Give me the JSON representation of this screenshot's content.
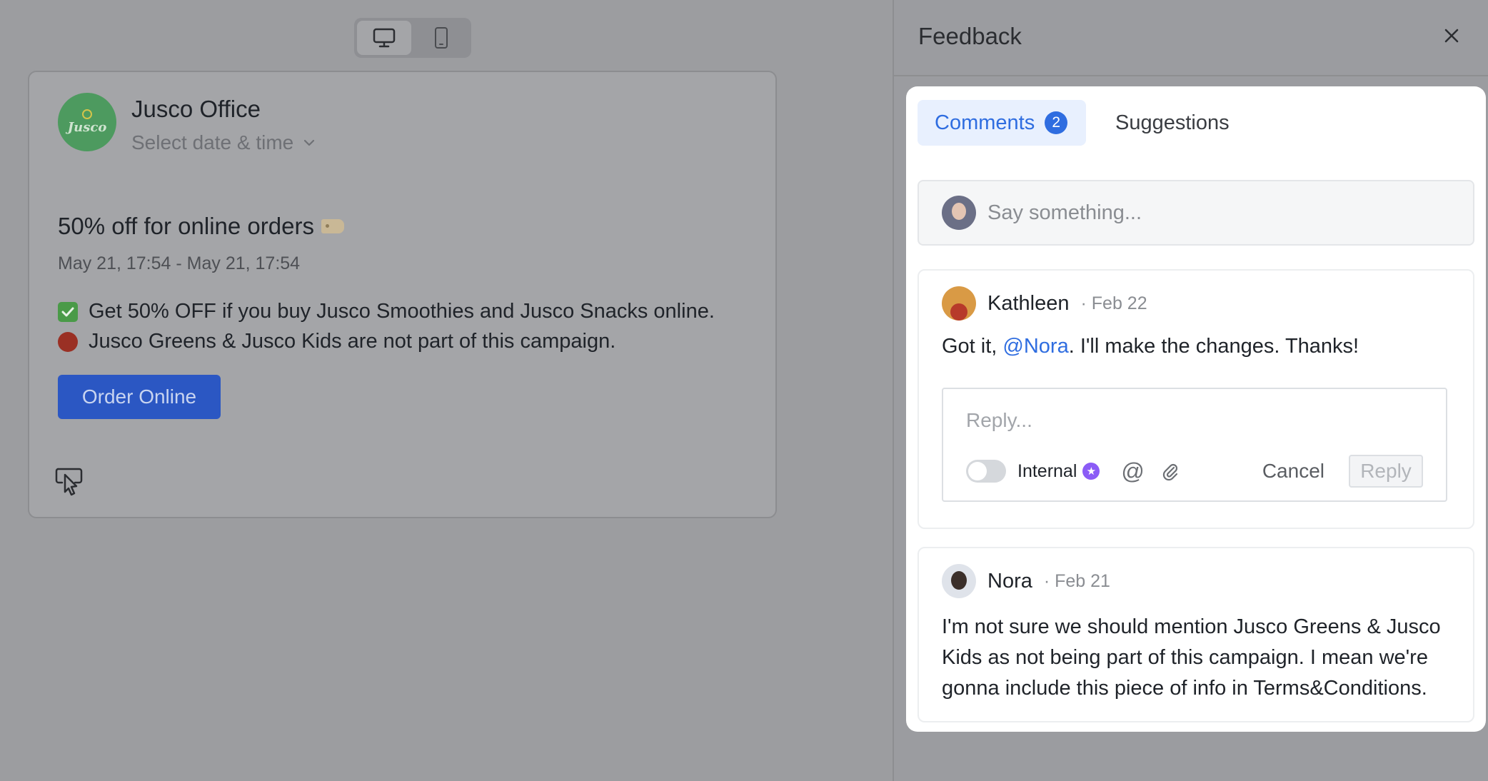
{
  "device_toggle": {
    "desktop_icon": "monitor-icon",
    "mobile_icon": "smartphone-icon"
  },
  "preview": {
    "brand_logo_text": "Jusco",
    "brand_name": "Jusco Office",
    "date_select": "Select date & time",
    "offer_title": "50% off for online orders",
    "offer_dates": "May 21, 17:54 - May 21, 17:54",
    "line1": "Get 50% OFF if you buy Jusco Smoothies and Jusco Snacks online.",
    "line2": "Jusco Greens & Jusco Kids are not part of this campaign.",
    "order_button": "Order Online"
  },
  "feedback": {
    "title": "Feedback",
    "tabs": {
      "comments_label": "Comments",
      "comments_count": "2",
      "suggestions_label": "Suggestions"
    },
    "input_placeholder": "Say something...",
    "comments": [
      {
        "author": "Kathleen",
        "date": "· Feb 22",
        "text_before": "Got it, ",
        "mention": "@Nora",
        "text_after": ". I'll make the changes. Thanks!"
      },
      {
        "author": "Nora",
        "date": "· Feb 21",
        "text": "I'm not sure we should mention Jusco Greens & Jusco Kids as not being part of this campaign. I mean we're gonna include this piece of info in Terms&Conditions."
      }
    ],
    "reply": {
      "placeholder": "Reply...",
      "internal_label": "Internal",
      "cancel_label": "Cancel",
      "reply_label": "Reply",
      "internal_on": false
    }
  },
  "colors": {
    "accent": "#2f6de0",
    "order_button": "#2b57c3",
    "overlay": "#9c9da0"
  }
}
